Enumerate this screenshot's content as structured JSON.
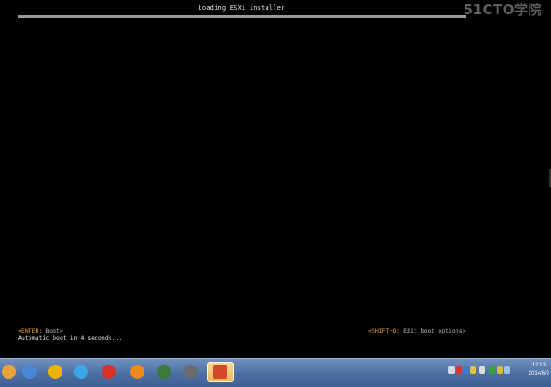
{
  "installer": {
    "title": "Loading ESXi installer",
    "progress": 1.0,
    "enter_key": "<ENTER:",
    "enter_action": " Boot>",
    "shift_key": "<SHIFT+O:",
    "shift_action": " Edit boot options>",
    "autoboot_text": "Automatic boot in 4 seconds..."
  },
  "watermark": "51CTO学院",
  "taskbar": {
    "icons": [
      {
        "name": "browser-icon",
        "color": "#e9a23b"
      },
      {
        "name": "network-icon",
        "color": "#4a86d6"
      },
      {
        "name": "qq-penguin-icon",
        "color": "#f0b400"
      },
      {
        "name": "internet-explorer-icon",
        "color": "#3da6e8"
      },
      {
        "name": "app-red-swirl-icon",
        "color": "#d8302a"
      },
      {
        "name": "app-orange-swirl-icon",
        "color": "#f08a1c"
      },
      {
        "name": "vm-player-icon",
        "color": "#3a7b3a"
      },
      {
        "name": "vmware-icon",
        "color": "#6b6b6b"
      },
      {
        "name": "powerpoint-icon",
        "color": "#d24726"
      }
    ],
    "clock_time": "12:13",
    "clock_date": "2014/6/2"
  }
}
